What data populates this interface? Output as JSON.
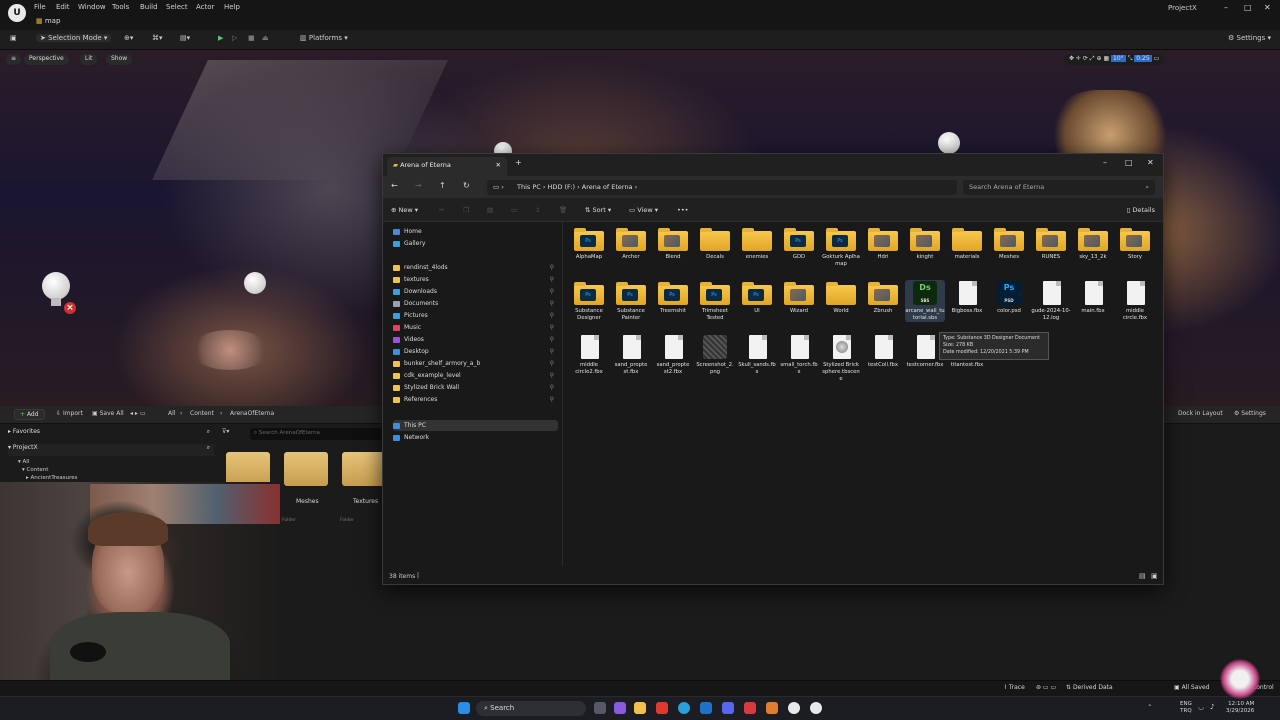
{
  "ue": {
    "menus": [
      "File",
      "Edit",
      "Window",
      "Tools",
      "Build",
      "Select",
      "Actor",
      "Help"
    ],
    "project": "ProjectX",
    "tab": "map",
    "toolbar": {
      "selection_mode": "Selection Mode",
      "platforms": "Platforms",
      "settings": "Settings"
    },
    "viewport": {
      "perspective": "Perspective",
      "lit": "Lit",
      "show": "Show",
      "snap_rot": "10°",
      "snap_scale": "0.25"
    },
    "content_browser": {
      "add": "Add",
      "import": "Import",
      "save_all": "Save All",
      "path": [
        "All",
        "Content",
        "ArenaOfEterna"
      ],
      "favorites": "Favorites",
      "project": "ProjectX",
      "search_placeholder": "Search ArenaOfEterna",
      "tree": [
        "All",
        "Content",
        "AncientTreasures"
      ],
      "folders": [
        "Meshes",
        "Textures"
      ],
      "folder_sub": "Folder",
      "dock": "Dock in Layout",
      "settings": "Settings"
    },
    "status": {
      "trace": "Trace",
      "derived_data": "Derived Data",
      "all_saved": "All Saved",
      "control": "Control"
    }
  },
  "explorer": {
    "tab_title": "Arena of Eterna",
    "breadcrumb": [
      "This PC",
      "HDD (F:)",
      "Arena of Eterna"
    ],
    "search_placeholder": "Search Arena of Eterna",
    "commands": {
      "new": "New",
      "sort": "Sort",
      "view": "View",
      "more": "•••",
      "details": "Details"
    },
    "nav": {
      "top": [
        "Home",
        "Gallery"
      ],
      "pinned": [
        "rendinst_4lods",
        "textures",
        "Downloads",
        "Documents",
        "Pictures",
        "Music",
        "Videos",
        "Desktop",
        "bunker_shelf_armory_a_b",
        "cdk_example_level",
        "Stylized Brick Wall",
        "References"
      ],
      "bottom": [
        "This PC",
        "Network"
      ]
    },
    "files_row1": [
      {
        "name": "AlphaMap",
        "kind": "folder",
        "badge": "Ps"
      },
      {
        "name": "Archer",
        "kind": "folder",
        "badge": "img"
      },
      {
        "name": "Blend",
        "kind": "folder",
        "badge": "img"
      },
      {
        "name": "Decals",
        "kind": "folder",
        "badge": ""
      },
      {
        "name": "enemies",
        "kind": "folder",
        "badge": ""
      },
      {
        "name": "GDD",
        "kind": "folder",
        "badge": "Ps"
      },
      {
        "name": "Gokturk Aplha map",
        "kind": "folder",
        "badge": "Ps"
      },
      {
        "name": "Hdri",
        "kind": "folder",
        "badge": "img"
      },
      {
        "name": "kinght",
        "kind": "folder",
        "badge": "img"
      },
      {
        "name": "materials",
        "kind": "folder",
        "badge": ""
      },
      {
        "name": "Meshes",
        "kind": "folder",
        "badge": "img"
      },
      {
        "name": "RUNES",
        "kind": "folder",
        "badge": "img"
      },
      {
        "name": "sky_13_2k",
        "kind": "folder",
        "badge": "img"
      },
      {
        "name": "Story",
        "kind": "folder",
        "badge": "img"
      }
    ],
    "files_row2": [
      {
        "name": "Substance Designer",
        "kind": "folder",
        "badge": "Ps"
      },
      {
        "name": "Substance Painter",
        "kind": "folder",
        "badge": "Ps"
      },
      {
        "name": "Treemshit",
        "kind": "folder",
        "badge": "Ps"
      },
      {
        "name": "Trimsheet Tested",
        "kind": "folder",
        "badge": "Ps"
      },
      {
        "name": "UI",
        "kind": "folder",
        "badge": "Ps"
      },
      {
        "name": "Wizard",
        "kind": "folder",
        "badge": "img"
      },
      {
        "name": "World",
        "kind": "folder",
        "badge": ""
      },
      {
        "name": "Zbrush",
        "kind": "folder",
        "badge": "img"
      },
      {
        "name": "arcane_wall_tutorial.sbs",
        "kind": "sbs",
        "badge": "Ds"
      },
      {
        "name": "Bigboss.fbx",
        "kind": "doc",
        "badge": ""
      },
      {
        "name": "color.psd",
        "kind": "psd",
        "badge": "Ps"
      },
      {
        "name": "gude-2024-10-12.log",
        "kind": "doc",
        "badge": ""
      },
      {
        "name": "main.fbx",
        "kind": "doc",
        "badge": ""
      },
      {
        "name": "middle circle.fbx",
        "kind": "doc",
        "badge": ""
      }
    ],
    "files_row3": [
      {
        "name": "middle circle2.fbx",
        "kind": "doc",
        "badge": ""
      },
      {
        "name": "sand_propte st.fbx",
        "kind": "doc",
        "badge": ""
      },
      {
        "name": "sand_propte st2.fbx",
        "kind": "doc",
        "badge": ""
      },
      {
        "name": "Screenshot_2.png",
        "kind": "img",
        "badge": ""
      },
      {
        "name": "Skull_sands.fbx",
        "kind": "doc",
        "badge": ""
      },
      {
        "name": "small_torch.fbx",
        "kind": "doc",
        "badge": ""
      },
      {
        "name": "Stylized Brick sphere.tbscene",
        "kind": "sphere",
        "badge": ""
      },
      {
        "name": "testColl.fbx",
        "kind": "doc",
        "badge": ""
      },
      {
        "name": "testcorner.fbx",
        "kind": "doc",
        "badge": ""
      },
      {
        "name": "titantest.fbx",
        "kind": "doc",
        "badge": ""
      }
    ],
    "tooltip": [
      "Type: Substance 3D Designer Document",
      "Size: 278 KB",
      "Date modified: 12/20/2021 5:39 PM"
    ],
    "item_count": "38 items"
  },
  "taskbar": {
    "search": "Search",
    "lang": "ENG",
    "region": "TRQ",
    "time": "12:10 AM",
    "date": "3/29/2026"
  }
}
